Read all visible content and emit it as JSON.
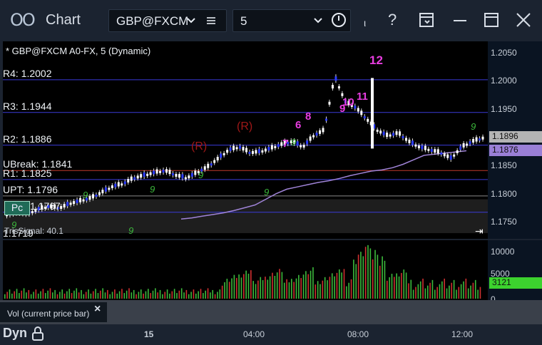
{
  "app": {
    "logo": "OO",
    "title": "Chart"
  },
  "toolbar": {
    "symbol_value": "GBP@FXCM",
    "interval_value": "5",
    "chevron": "❯",
    "menu_icon": "menu-icon",
    "sep_glyph": "ι",
    "help_glyph": "?"
  },
  "chart": {
    "header": "* GBP@FXCM A0-FX, 5 (Dynamic)",
    "levels": [
      {
        "label": "R4: 1.2002",
        "price": 1.2002,
        "color": "#3a3ad8"
      },
      {
        "label": "R3: 1.1944",
        "price": 1.1944,
        "color": "#3a3ad8"
      },
      {
        "label": "R2: 1.1886",
        "price": 1.1886,
        "color": "#3a3ad8"
      },
      {
        "label": "UBreak: 1.1841",
        "price": 1.1841,
        "color": "#c0392b"
      },
      {
        "label": "R1: 1.1825",
        "price": 1.1825,
        "color": "#3a3ad8"
      },
      {
        "label": "UPT: 1.1796",
        "price": 1.1796,
        "color": "#8a8a8a"
      },
      {
        "label": "1.1767",
        "price": 1.1767,
        "color": "#3a3ad8"
      },
      {
        "label": "1.1719",
        "price": 1.1719,
        "color": "#3fa3a0"
      }
    ],
    "badge": "Pc",
    "tris_signal": "TrisSignal: 40.1",
    "reversal_marks": [
      "(R)",
      "(R)"
    ],
    "counts": [
      "7",
      "6",
      "8",
      "10",
      "11",
      "12",
      "9"
    ],
    "green_counts": [
      "9",
      "9",
      "9",
      "9",
      "9",
      "9",
      "9",
      "9"
    ],
    "last_price": "1.1896",
    "prev_price": "1.1876"
  },
  "price_axis": {
    "ticks": [
      "1.2050",
      "1.2000",
      "1.1950",
      "1.1900",
      "1.1850",
      "1.1800",
      "1.1750"
    ]
  },
  "volume": {
    "label": "Vol (current price bar)",
    "ticks": [
      "10000",
      "5000",
      "0"
    ],
    "current": "3121"
  },
  "time_axis": {
    "ticks": [
      "15",
      "04:00",
      "08:00",
      "12:00"
    ]
  },
  "status": {
    "mode": "Dyn"
  },
  "chart_data": {
    "type": "candlestick",
    "y_range": [
      1.172,
      1.207
    ],
    "close_path_prices": [
      1.176,
      1.1765,
      1.1762,
      1.177,
      1.1775,
      1.1772,
      1.178,
      1.1785,
      1.179,
      1.18,
      1.181,
      1.1815,
      1.1825,
      1.183,
      1.1835,
      1.1838,
      1.183,
      1.1825,
      1.1835,
      1.1845,
      1.186,
      1.1875,
      1.188,
      1.187,
      1.1872,
      1.1878,
      1.1885,
      1.189,
      1.188,
      1.19,
      1.191,
      1.2005,
      1.196,
      1.195,
      1.193,
      1.191,
      1.19,
      1.1905,
      1.189,
      1.188,
      1.1875,
      1.187,
      1.186,
      1.188,
      1.189,
      1.1896
    ],
    "ma_prices": [
      1.1755,
      1.1757,
      1.176,
      1.1763,
      1.1766,
      1.177,
      1.1775,
      1.178,
      1.179,
      1.18,
      1.1808,
      1.1812,
      1.1816,
      1.182,
      1.1823,
      1.1827,
      1.1832,
      1.1836,
      1.184,
      1.1842,
      1.1846,
      1.1852,
      1.186,
      1.1868,
      1.187,
      1.1872,
      1.1874,
      1.1876
    ]
  }
}
